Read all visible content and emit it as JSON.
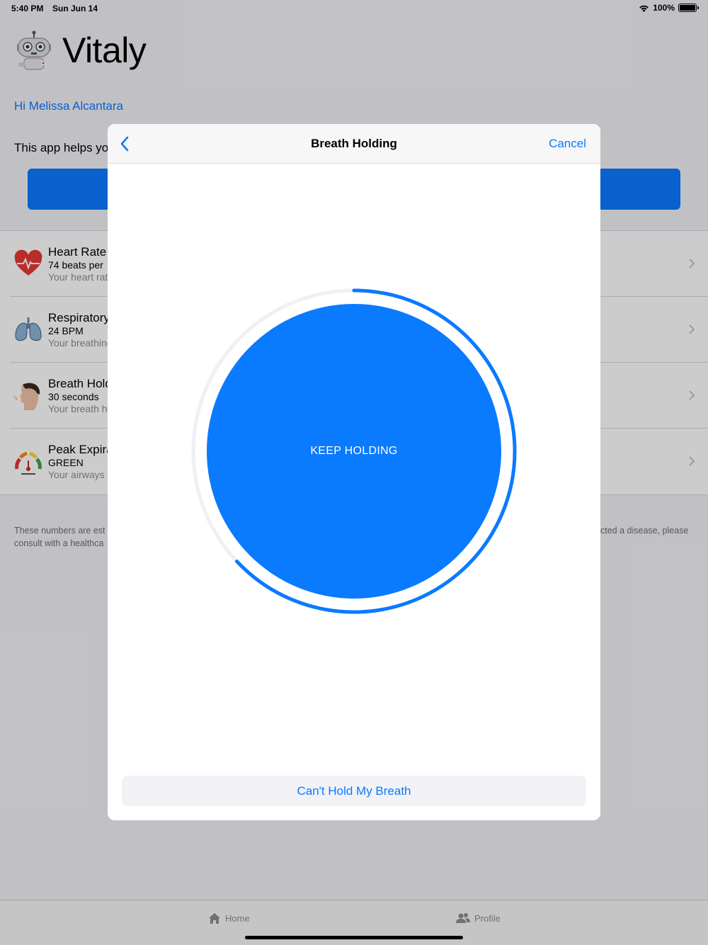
{
  "status_bar": {
    "time": "5:40 PM",
    "date": "Sun Jun 14",
    "battery": "100%"
  },
  "app": {
    "title": "Vitaly",
    "greeting": "Hi Melissa Alcantara",
    "intro": "This app helps you",
    "items": [
      {
        "title": "Heart Rate",
        "value": "74 beats per",
        "desc": "Your heart rate",
        "icon": "heart-icon"
      },
      {
        "title": "Respiratory",
        "value": "24 BPM",
        "desc": "Your breathing",
        "icon": "lungs-icon"
      },
      {
        "title": "Breath Hold",
        "value": "30 seconds",
        "desc": "Your breath h",
        "icon": "person-breath-icon"
      },
      {
        "title": "Peak Expira",
        "value": "GREEN",
        "desc": "Your airways",
        "icon": "gauge-icon"
      }
    ],
    "disclaimer_left": [
      "These numbers are est",
      "consult with a healthca"
    ],
    "disclaimer_right": "cted a disease, please",
    "tabs": {
      "home": "Home",
      "profile": "Profile"
    }
  },
  "modal": {
    "title": "Breath Holding",
    "cancel": "Cancel",
    "circle_label": "KEEP HOLDING",
    "progress": 0.63,
    "button": "Can't Hold My Breath"
  },
  "colors": {
    "accent": "#0a7aff",
    "track": "#efeff4"
  }
}
